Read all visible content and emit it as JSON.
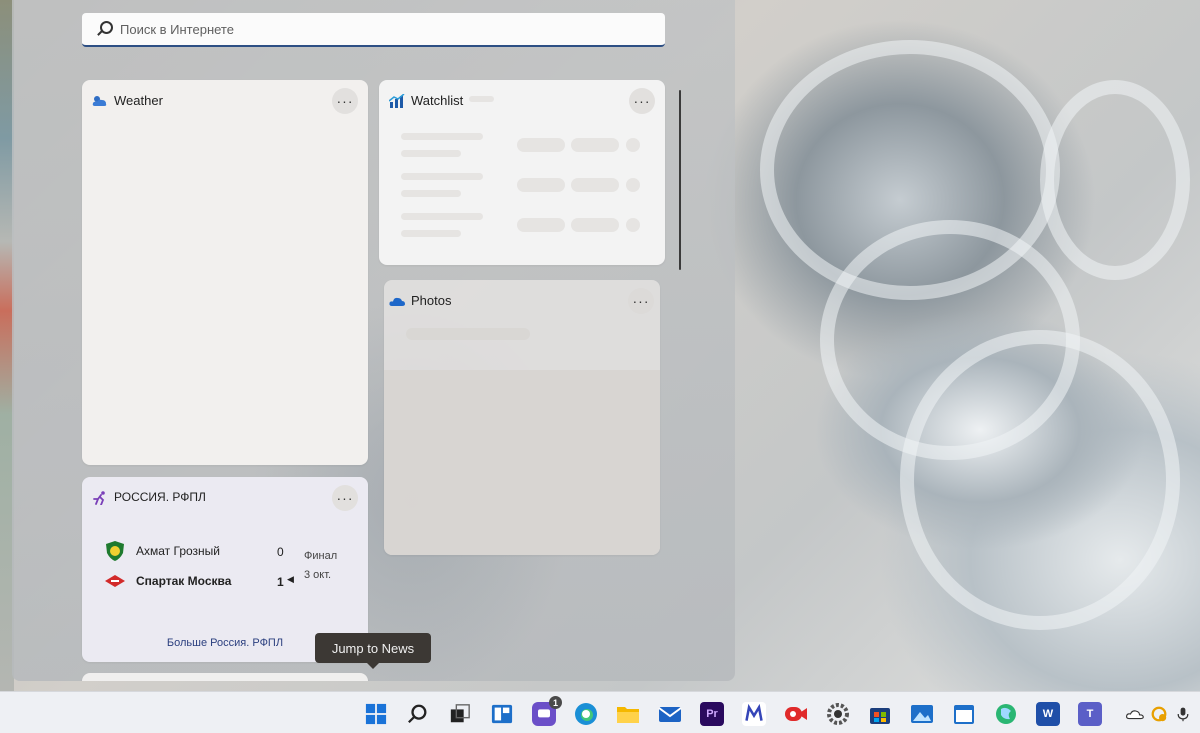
{
  "search": {
    "placeholder": "Поиск в Интернете"
  },
  "widgets": {
    "weather": {
      "title": "Weather",
      "more": "···"
    },
    "watchlist": {
      "title": "Watchlist",
      "more": "···"
    },
    "photos": {
      "title": "Photos",
      "more": "···"
    },
    "sports": {
      "title": "РОССИЯ. РФПЛ",
      "more": "···",
      "match": {
        "home_team": "Ахмат Грозный",
        "home_score": "0",
        "away_team": "Спартак Москва",
        "away_score": "1",
        "status": "Финал",
        "date": "3 окт."
      },
      "link": "Больше Россия. РФПЛ"
    }
  },
  "tooltip": {
    "text": "Jump to News"
  },
  "taskbar": {
    "chat_badge": "1",
    "apps": [
      "start-icon",
      "search-icon",
      "task-view-icon",
      "widgets-icon",
      "chat-icon",
      "edge-icon",
      "file-explorer-icon",
      "mail-icon",
      "premiere-icon",
      "miro-icon",
      "record-icon",
      "settings-icon",
      "store-icon",
      "photos-icon",
      "calendar-icon",
      "maps-icon",
      "word-icon",
      "teams-icon"
    ],
    "word_label": "W",
    "premiere_label": "Pr",
    "teams_label": "T"
  },
  "colors": {
    "accent": "#2d4f84",
    "link": "#2b3f7f",
    "tooltip_bg": "#3c3834"
  }
}
